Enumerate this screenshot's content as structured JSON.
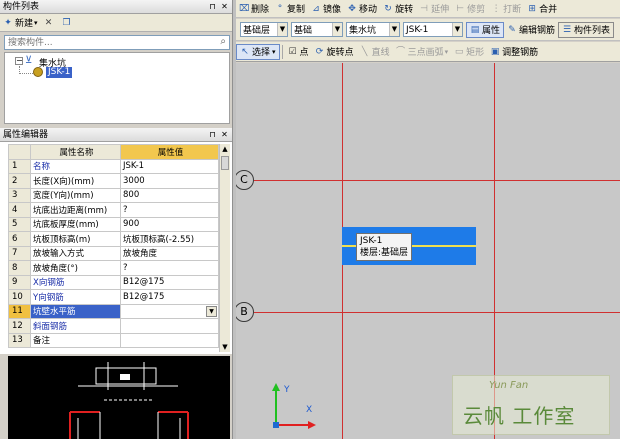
{
  "left_panel": {
    "title": "构件列表",
    "new_button": "新建",
    "search_placeholder": "搜索构件...",
    "tree_root": "集水坑",
    "tree_child": "JSK-1"
  },
  "props_panel": {
    "title": "属性编辑器",
    "col_name": "属性名称",
    "col_value": "属性值",
    "rows": [
      {
        "n": "1",
        "name": "名称",
        "value": "JSK-1",
        "blue": true
      },
      {
        "n": "2",
        "name": "长度(X向)(mm)",
        "value": "3000",
        "blue": false
      },
      {
        "n": "3",
        "name": "宽度(Y向)(mm)",
        "value": "800",
        "blue": false
      },
      {
        "n": "4",
        "name": "坑底出边距离(mm)",
        "value": "?",
        "blue": false
      },
      {
        "n": "5",
        "name": "坑底板厚度(mm)",
        "value": "900",
        "blue": false
      },
      {
        "n": "6",
        "name": "坑板顶标高(m)",
        "value": "坑板顶标高(-2.55)",
        "blue": false
      },
      {
        "n": "7",
        "name": "放坡输入方式",
        "value": "放坡角度",
        "blue": false
      },
      {
        "n": "8",
        "name": "放坡角度(°)",
        "value": "?",
        "blue": false
      },
      {
        "n": "9",
        "name": "X向钢筋",
        "value": "B12@175",
        "blue": true
      },
      {
        "n": "10",
        "name": "Y向钢筋",
        "value": "B12@175",
        "blue": true
      },
      {
        "n": "11",
        "name": "坑壁水平筋",
        "value": "",
        "blue": true,
        "selected": true
      },
      {
        "n": "12",
        "name": "斜面钢筋",
        "value": "",
        "blue": true
      },
      {
        "n": "13",
        "name": "备注",
        "value": "",
        "blue": false
      }
    ]
  },
  "toolbar1": {
    "delete": "删除",
    "copy": "复制",
    "mirror": "镜像",
    "move": "移动",
    "rotate": "旋转",
    "extend": "延伸",
    "trim": "修剪",
    "break": "打断",
    "merge": "合并"
  },
  "toolbar2": {
    "floor": "基础层",
    "category": "基础",
    "type": "集水坑",
    "component": "JSK-1",
    "property_button": "属性",
    "edit_rebar": "编辑钢筋",
    "component_list": "构件列表"
  },
  "toolbar3": {
    "select": "选择",
    "point": "点",
    "rotate_point": "旋转点",
    "line": "直线",
    "three_point_arc": "三点画弧",
    "rectangle": "矩形",
    "adjust_rebar": "调整钢筋"
  },
  "canvas": {
    "axis_c": "C",
    "axis_b": "B",
    "tooltip_name": "JSK-1",
    "tooltip_floor": "楼层:基础层",
    "ucs_y": "Y",
    "ucs_x": "X",
    "watermark_en": "Yun Fan",
    "watermark_cn": "云帆 工作室"
  },
  "colors": {
    "canvas_bg": "#c8c8c8",
    "grid_line": "#d03030",
    "pit_fill": "#1e7be8",
    "selection_blue": "#3a62c8"
  }
}
